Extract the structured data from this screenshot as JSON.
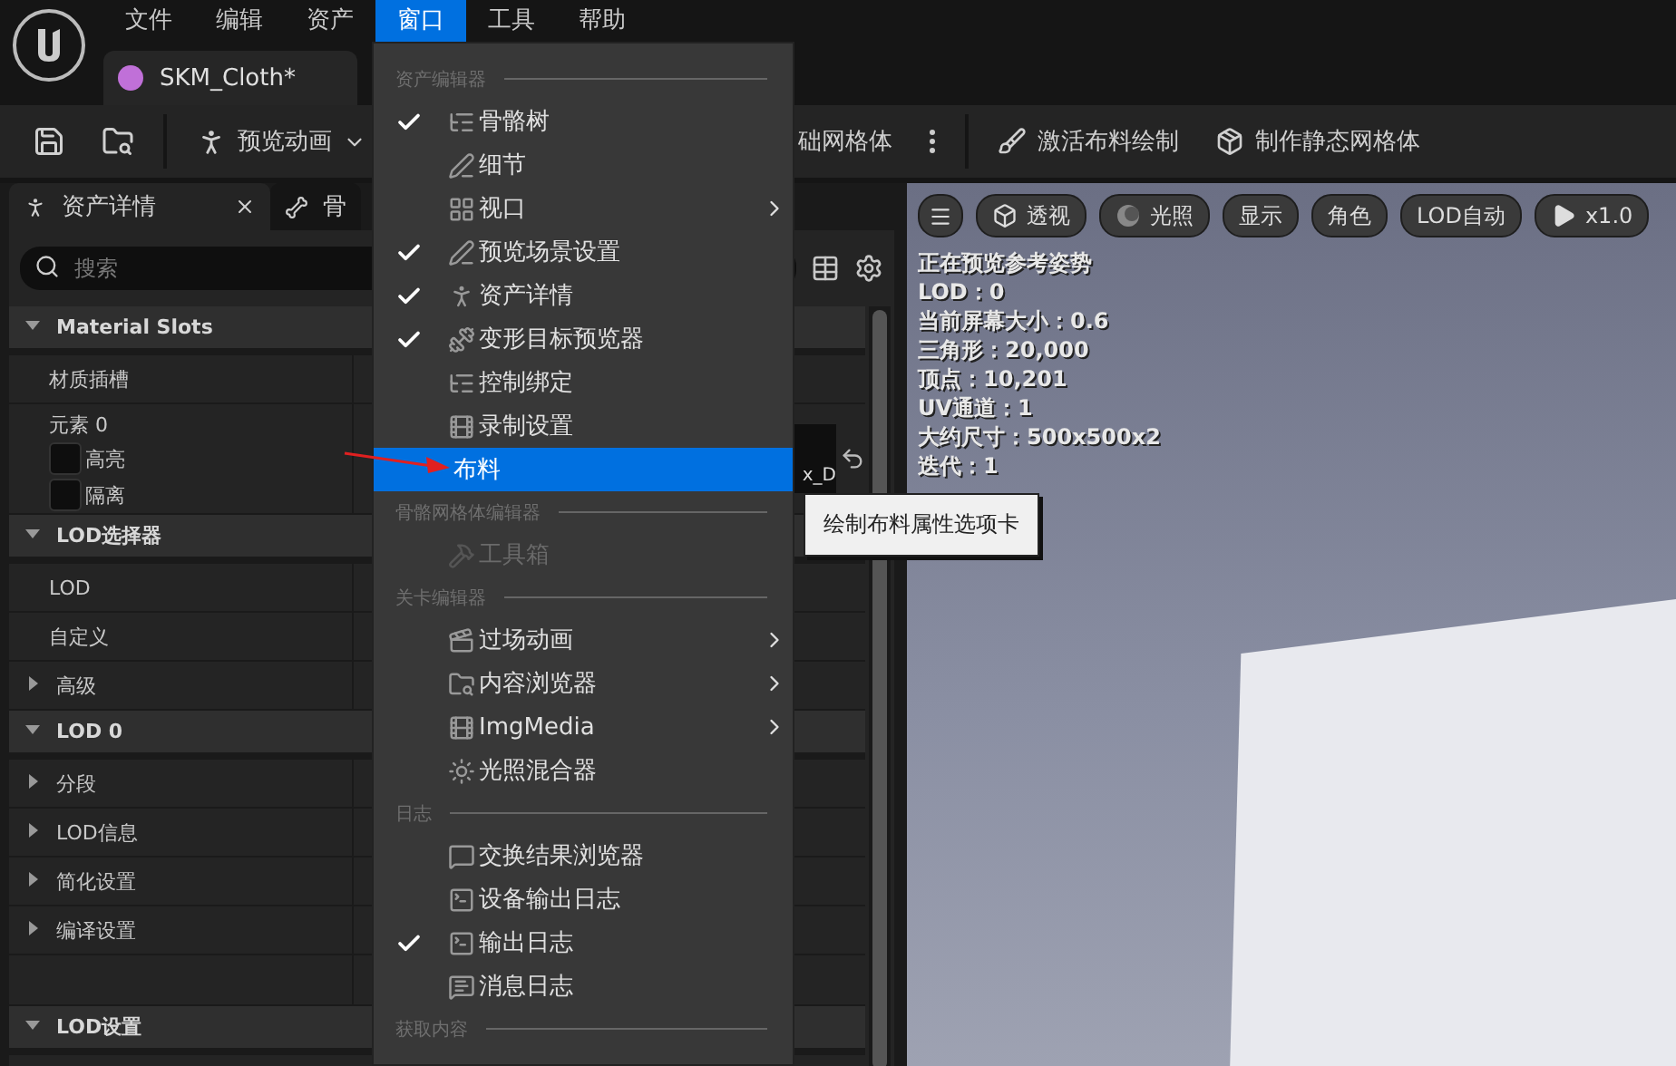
{
  "menubar": [
    {
      "label": "文件",
      "selected": false
    },
    {
      "label": "编辑",
      "selected": false
    },
    {
      "label": "资产",
      "selected": false
    },
    {
      "label": "窗口",
      "selected": true
    },
    {
      "label": "工具",
      "selected": false
    },
    {
      "label": "帮助",
      "selected": false
    }
  ],
  "document_tab": {
    "label": "SKM_Cloth*"
  },
  "toolbar": {
    "preview_button": "预览动画",
    "partial_label": "础网格体",
    "actions": [
      {
        "label": "激活布料绘制"
      },
      {
        "label": "制作静态网格体"
      }
    ]
  },
  "details_panel": {
    "tabs": [
      {
        "label": "资产详情",
        "selected": true
      },
      {
        "label": "骨",
        "selected": false
      }
    ],
    "search": {
      "placeholder": "搜索"
    },
    "sections": [
      {
        "title": "Material Slots",
        "expanded": true,
        "rows": [
          {
            "kind": "property",
            "label": "材质插槽"
          },
          {
            "kind": "element",
            "label": "元素 0",
            "value": "x_D",
            "options": [
              {
                "label": "高亮",
                "checked": false
              },
              {
                "label": "隔离",
                "checked": false
              }
            ]
          }
        ]
      },
      {
        "title": "LOD选择器",
        "expanded": true,
        "rows": [
          {
            "kind": "property",
            "label": "LOD"
          },
          {
            "kind": "property",
            "label": "自定义"
          },
          {
            "kind": "group",
            "label": "高级",
            "expanded": false
          }
        ]
      },
      {
        "title": "LOD 0",
        "expanded": true,
        "rows": [
          {
            "kind": "group",
            "label": "分段",
            "expanded": false
          },
          {
            "kind": "group",
            "label": "LOD信息",
            "expanded": false
          },
          {
            "kind": "group",
            "label": "简化设置",
            "expanded": false
          },
          {
            "kind": "group",
            "label": "编译设置",
            "expanded": false
          },
          {
            "kind": "blank"
          }
        ]
      },
      {
        "title": "LOD设置",
        "expanded": true
      }
    ]
  },
  "window_menu": {
    "sections": [
      {
        "title": "资产编辑器",
        "items": [
          {
            "label": "骨骼树",
            "checked": true,
            "submenu": false,
            "disabled": false,
            "selected": false
          },
          {
            "label": "细节",
            "checked": false,
            "submenu": false,
            "disabled": false,
            "selected": false
          },
          {
            "label": "视口",
            "checked": false,
            "submenu": true,
            "disabled": false,
            "selected": false
          },
          {
            "label": "预览场景设置",
            "checked": true,
            "submenu": false,
            "disabled": false,
            "selected": false
          },
          {
            "label": "资产详情",
            "checked": true,
            "submenu": false,
            "disabled": false,
            "selected": false
          },
          {
            "label": "变形目标预览器",
            "checked": true,
            "submenu": false,
            "disabled": false,
            "selected": false
          },
          {
            "label": "控制绑定",
            "checked": false,
            "submenu": false,
            "disabled": false,
            "selected": false
          },
          {
            "label": "录制设置",
            "checked": false,
            "submenu": false,
            "disabled": false,
            "selected": false
          },
          {
            "label": "布料",
            "checked": false,
            "submenu": false,
            "disabled": false,
            "selected": true
          }
        ]
      },
      {
        "title": "骨骼网格体编辑器",
        "items": [
          {
            "label": "工具箱",
            "checked": false,
            "submenu": false,
            "disabled": true,
            "selected": false
          }
        ]
      },
      {
        "title": "关卡编辑器",
        "items": [
          {
            "label": "过场动画",
            "checked": false,
            "submenu": true,
            "disabled": false,
            "selected": false
          },
          {
            "label": "内容浏览器",
            "checked": false,
            "submenu": true,
            "disabled": false,
            "selected": false
          },
          {
            "label": "ImgMedia",
            "checked": false,
            "submenu": true,
            "disabled": false,
            "selected": false
          },
          {
            "label": "光照混合器",
            "checked": false,
            "submenu": false,
            "disabled": false,
            "selected": false
          }
        ]
      },
      {
        "title": "日志",
        "items": [
          {
            "label": "交换结果浏览器",
            "checked": false,
            "submenu": false,
            "disabled": false,
            "selected": false
          },
          {
            "label": "设备输出日志",
            "checked": false,
            "submenu": false,
            "disabled": false,
            "selected": false
          },
          {
            "label": "输出日志",
            "checked": true,
            "submenu": false,
            "disabled": false,
            "selected": false
          },
          {
            "label": "消息日志",
            "checked": false,
            "submenu": false,
            "disabled": false,
            "selected": false
          }
        ]
      },
      {
        "title": "获取内容"
      }
    ]
  },
  "tooltip": "绘制布料属性选项卡",
  "viewport": {
    "buttons": [
      {
        "kind": "menu"
      },
      {
        "kind": "cube",
        "label": "透视"
      },
      {
        "kind": "sphere",
        "label": "光照"
      },
      {
        "kind": "text",
        "label": "显示"
      },
      {
        "kind": "text",
        "label": "角色"
      },
      {
        "kind": "text",
        "label": "LOD自动"
      },
      {
        "kind": "play",
        "label": "x1.0"
      }
    ],
    "stats": [
      "正在预览参考姿势",
      "LOD：0",
      "当前屏幕大小：0.6",
      "三角形：20,000",
      "顶点：10,201",
      "UV通道：1",
      "大约尺寸：500x500x2",
      "迭代：1"
    ]
  }
}
